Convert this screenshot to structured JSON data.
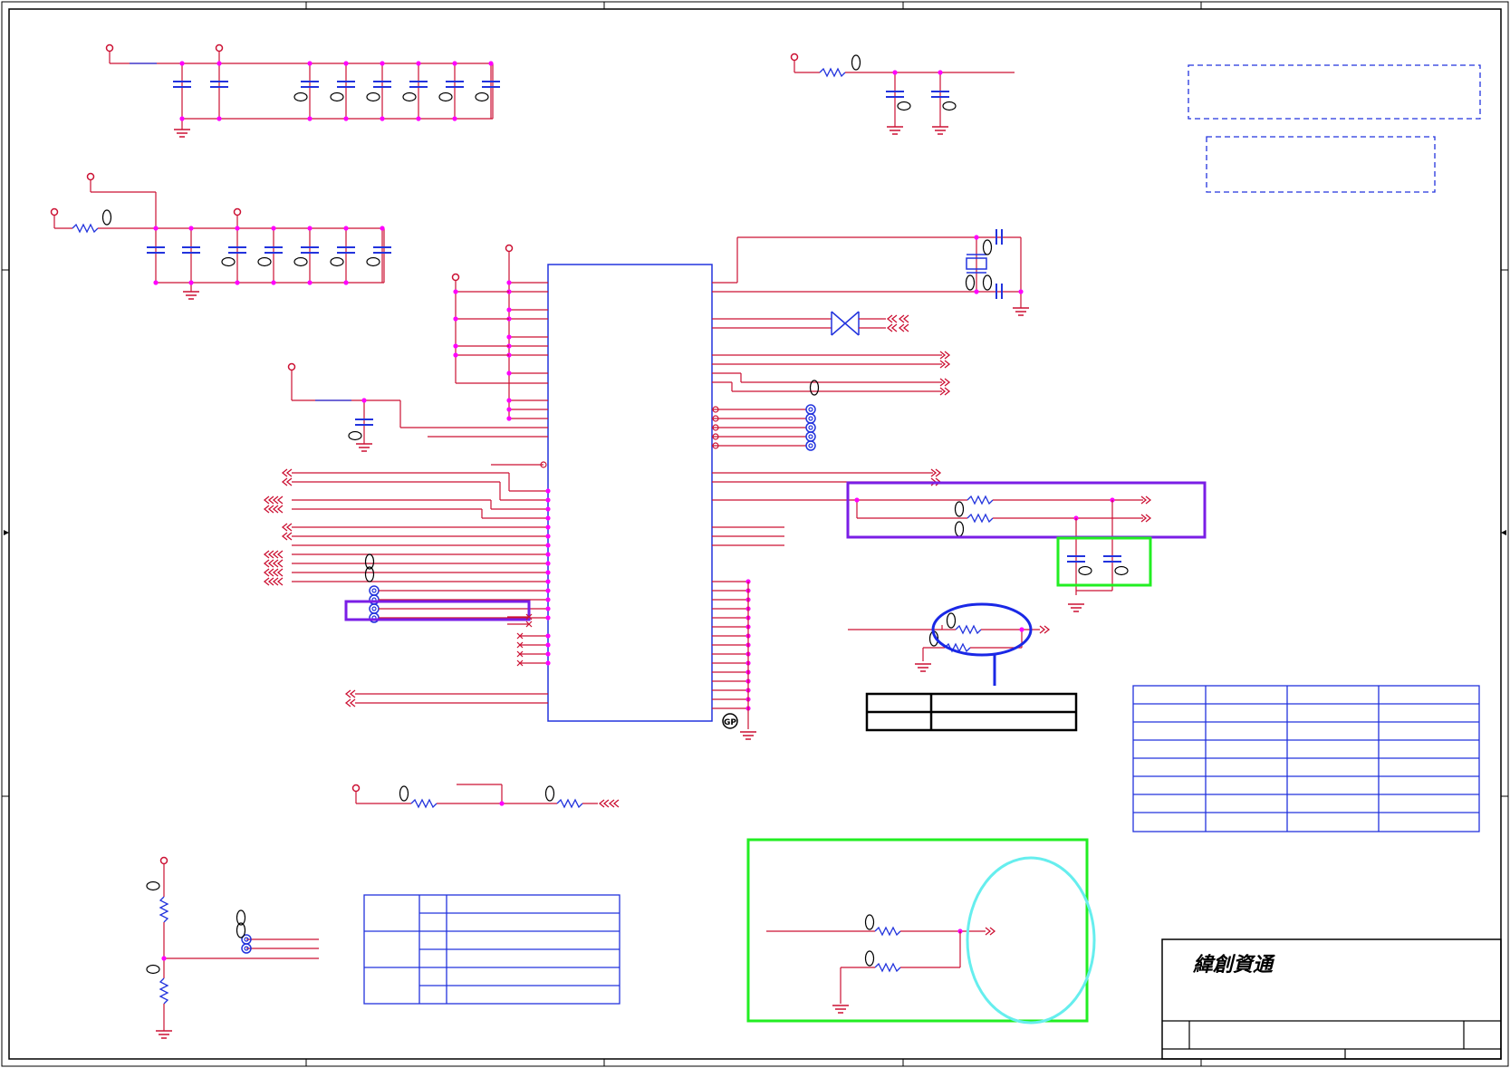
{
  "title_block": {
    "company_logo_text": "緯創資通"
  },
  "markers": {
    "ground_plane_label": "GP"
  },
  "colors": {
    "wire": "#cc1133",
    "component": "#2233dd",
    "junction": "#ff00ff",
    "sheet_border": "#000000",
    "highlight_purple": "#7a1ee6",
    "highlight_green": "#22ee22",
    "highlight_cyan": "#66eeee",
    "highlight_blue": "#1a28e6"
  }
}
